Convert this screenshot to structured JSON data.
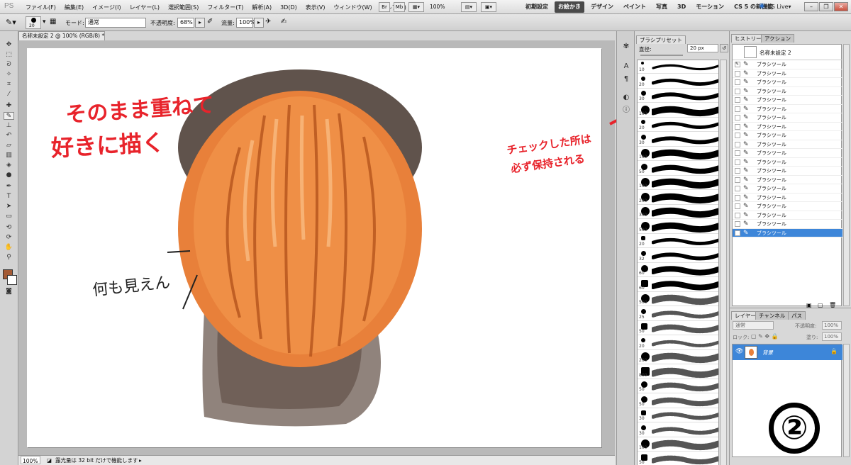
{
  "menubar": {
    "logo": "PS",
    "items": [
      "ファイル(F)",
      "編集(E)",
      "イメージ(I)",
      "レイヤー(L)",
      "選択範囲(S)",
      "フィルター(T)",
      "解析(A)",
      "3D(D)",
      "表示(V)",
      "ウィンドウ(W)",
      "ヘルプ(H)"
    ],
    "zoom": "100%",
    "workspaces": [
      "初期設定",
      "お絵かき",
      "デザイン",
      "ペイント",
      "写真",
      "3D",
      "モーション",
      "CS 5 の新機能"
    ],
    "active_workspace": "お絵かき",
    "cs_live": "CS Live▾"
  },
  "options": {
    "brush_size": "20",
    "mode_label": "モード:",
    "mode_value": "通常",
    "opacity_label": "不透明度:",
    "opacity_value": "68%",
    "flow_label": "流量:",
    "flow_value": "100%"
  },
  "document": {
    "tab_title": "名称未設定 2 @ 100% (RGB/8) *",
    "status_zoom": "100%",
    "status_text": "露光量は 32 bit だけで機能します"
  },
  "canvas_annotations": {
    "red_title_1": "そのまま重ねて",
    "red_title_2": "好きに描く",
    "black_note": "何も見えん",
    "red_note_1": "チェックした所は",
    "red_note_2": "必ず保持される",
    "step_number": "②"
  },
  "brush_panel": {
    "tabs": [
      "ブラシプリセット"
    ],
    "diameter_label": "直径:",
    "diameter_value": "20 px",
    "sizes": [
      "10",
      "20",
      "30",
      "100",
      "20",
      "30",
      "100",
      "50",
      "100",
      "200",
      "300",
      "500",
      "20",
      "32",
      "60",
      "60",
      "500",
      "25",
      "50",
      "20",
      "200",
      "800",
      "50",
      "50",
      "30",
      "30",
      "100",
      "50",
      "50"
    ]
  },
  "history_panel": {
    "tabs": [
      "ヒストリー",
      "アクション"
    ],
    "snapshot_name": "名称未設定 2",
    "items": [
      "ブラシツール",
      "ブラシツール",
      "ブラシツール",
      "ブラシツール",
      "ブラシツール",
      "ブラシツール",
      "ブラシツール",
      "ブラシツール",
      "ブラシツール",
      "ブラシツール",
      "ブラシツール",
      "ブラシツール",
      "ブラシツール",
      "ブラシツール",
      "ブラシツール",
      "ブラシツール",
      "ブラシツール",
      "ブラシツール",
      "ブラシツール",
      "ブラシツール"
    ],
    "selected_index": 19,
    "checked_index": 0
  },
  "layers_panel": {
    "tabs": [
      "レイヤー",
      "チャンネル",
      "パス"
    ],
    "blend_mode": "通常",
    "opacity_label": "不透明度:",
    "opacity_value": "100%",
    "lock_label": "ロック:",
    "fill_label": "塗り:",
    "fill_value": "100%",
    "layer_name": "背景"
  },
  "colors": {
    "accent_selection": "#3d86d9",
    "foreground": "#a45a34",
    "annotation_red": "#e8232b",
    "pumpkin_orange": "#e8803a",
    "dark_shadow": "#5a4a42"
  }
}
